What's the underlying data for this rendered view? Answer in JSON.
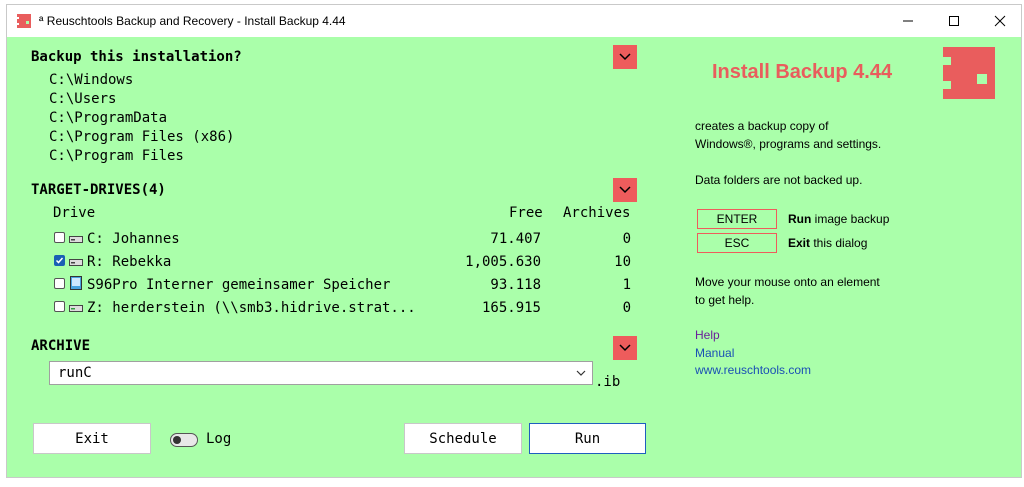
{
  "window": {
    "title": "ª Reuschtools Backup and Recovery - Install Backup 4.44"
  },
  "backup": {
    "header": "Backup this installation?",
    "paths": [
      "C:\\Windows",
      "C:\\Users",
      "C:\\ProgramData",
      "C:\\Program Files (x86)",
      "C:\\Program Files"
    ]
  },
  "target": {
    "header": "TARGET-DRIVES(4)",
    "columns": {
      "drive": "Drive",
      "free": "Free",
      "archives": "Archives"
    },
    "drives": [
      {
        "name": "C:  Johannes",
        "free": "71.407",
        "archives": "0",
        "checked": false
      },
      {
        "name": "R:  Rebekka",
        "free": "1,005.630",
        "archives": "10",
        "checked": true
      },
      {
        "name": "S96Pro Interner gemeinsamer Speicher",
        "free": "93.118",
        "archives": "1",
        "checked": false
      },
      {
        "name": "Z:  herderstein (\\\\smb3.hidrive.strat...",
        "free": "165.915",
        "archives": "0",
        "checked": false
      }
    ]
  },
  "archive": {
    "header": "ARCHIVE",
    "value": "runC",
    "suffix": ".ib"
  },
  "buttons": {
    "exit": "Exit",
    "log": "Log",
    "schedule": "Schedule",
    "run": "Run"
  },
  "side": {
    "heading": "Install Backup 4.44",
    "desc1": "creates a backup copy of",
    "desc2": "Windows®, programs and settings.",
    "note": "Data folders are not backed up.",
    "enter_key": "ENTER",
    "enter_bold": "Run",
    "enter_text": " image backup",
    "esc_key": "ESC",
    "esc_bold": "Exit",
    "esc_text": " this dialog",
    "help1": "Move your mouse onto an element",
    "help2": "to get help.",
    "link_help": "Help",
    "link_manual": "Manual",
    "link_site": "www.reuschtools.com"
  },
  "colors": {
    "background": "#aaffaa",
    "accent": "#ee5c5c",
    "heading": "#e95d5d",
    "link": "#1a4fb5"
  }
}
